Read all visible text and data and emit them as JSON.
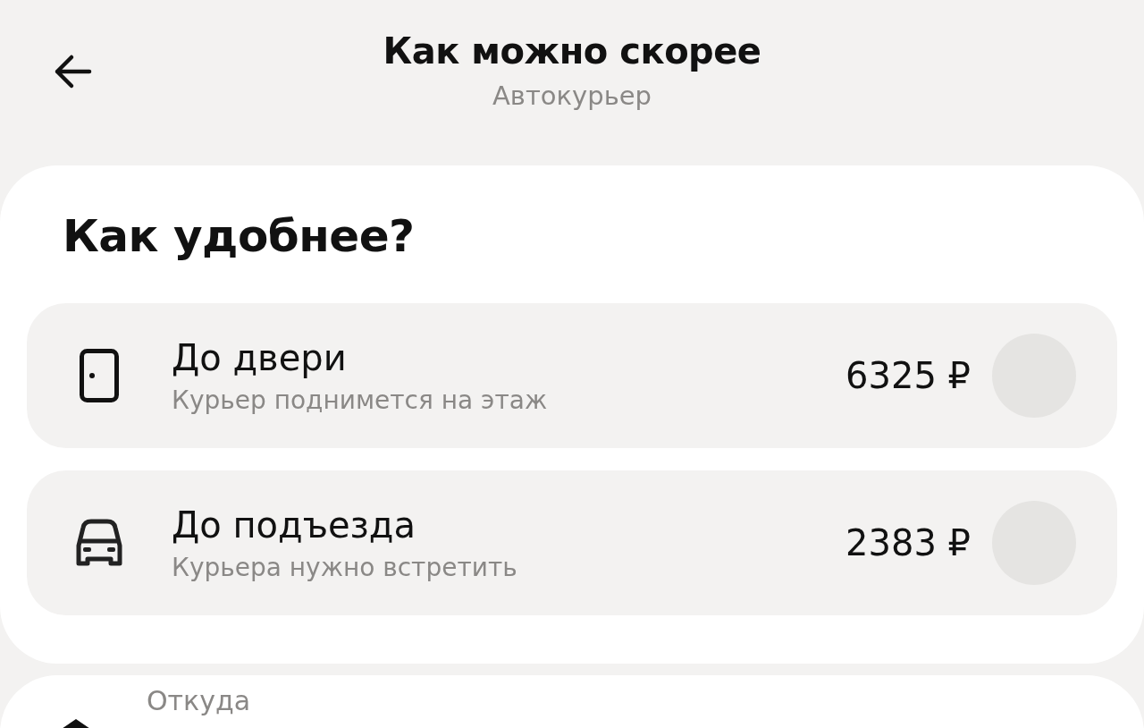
{
  "header": {
    "title": "Как можно скорее",
    "subtitle": "Автокурьер"
  },
  "question": "Как удобнее?",
  "options": [
    {
      "kind": "door",
      "title": "До двери",
      "subtitle": "Курьер поднимется на этаж",
      "price": "6325 ₽",
      "selected": false
    },
    {
      "kind": "car",
      "title": "До подъезда",
      "subtitle": "Курьера нужно встретить",
      "price": "2383 ₽",
      "selected": false
    }
  ],
  "route": {
    "from_label": "Откуда"
  }
}
